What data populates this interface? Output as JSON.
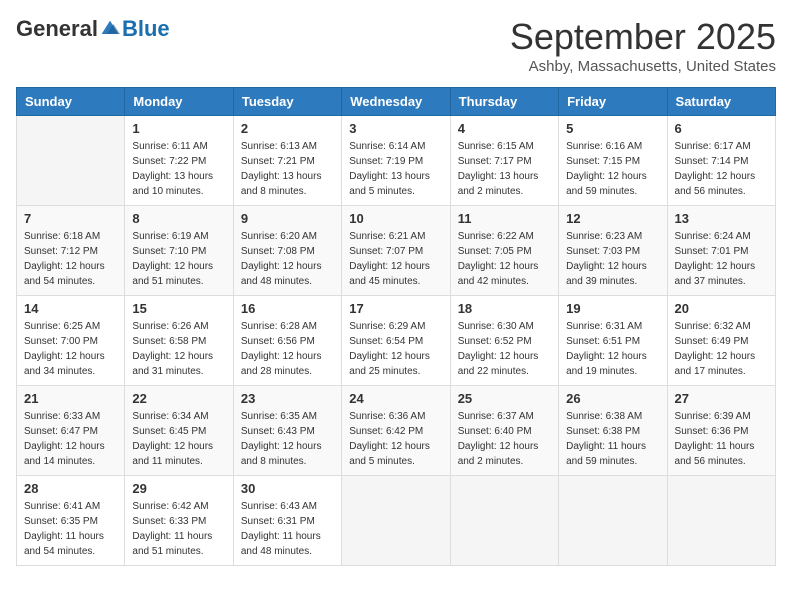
{
  "logo": {
    "general": "General",
    "blue": "Blue"
  },
  "title": "September 2025",
  "location": "Ashby, Massachusetts, United States",
  "days_of_week": [
    "Sunday",
    "Monday",
    "Tuesday",
    "Wednesday",
    "Thursday",
    "Friday",
    "Saturday"
  ],
  "weeks": [
    [
      {
        "day": "",
        "info": ""
      },
      {
        "day": "1",
        "info": "Sunrise: 6:11 AM\nSunset: 7:22 PM\nDaylight: 13 hours\nand 10 minutes."
      },
      {
        "day": "2",
        "info": "Sunrise: 6:13 AM\nSunset: 7:21 PM\nDaylight: 13 hours\nand 8 minutes."
      },
      {
        "day": "3",
        "info": "Sunrise: 6:14 AM\nSunset: 7:19 PM\nDaylight: 13 hours\nand 5 minutes."
      },
      {
        "day": "4",
        "info": "Sunrise: 6:15 AM\nSunset: 7:17 PM\nDaylight: 13 hours\nand 2 minutes."
      },
      {
        "day": "5",
        "info": "Sunrise: 6:16 AM\nSunset: 7:15 PM\nDaylight: 12 hours\nand 59 minutes."
      },
      {
        "day": "6",
        "info": "Sunrise: 6:17 AM\nSunset: 7:14 PM\nDaylight: 12 hours\nand 56 minutes."
      }
    ],
    [
      {
        "day": "7",
        "info": "Sunrise: 6:18 AM\nSunset: 7:12 PM\nDaylight: 12 hours\nand 54 minutes."
      },
      {
        "day": "8",
        "info": "Sunrise: 6:19 AM\nSunset: 7:10 PM\nDaylight: 12 hours\nand 51 minutes."
      },
      {
        "day": "9",
        "info": "Sunrise: 6:20 AM\nSunset: 7:08 PM\nDaylight: 12 hours\nand 48 minutes."
      },
      {
        "day": "10",
        "info": "Sunrise: 6:21 AM\nSunset: 7:07 PM\nDaylight: 12 hours\nand 45 minutes."
      },
      {
        "day": "11",
        "info": "Sunrise: 6:22 AM\nSunset: 7:05 PM\nDaylight: 12 hours\nand 42 minutes."
      },
      {
        "day": "12",
        "info": "Sunrise: 6:23 AM\nSunset: 7:03 PM\nDaylight: 12 hours\nand 39 minutes."
      },
      {
        "day": "13",
        "info": "Sunrise: 6:24 AM\nSunset: 7:01 PM\nDaylight: 12 hours\nand 37 minutes."
      }
    ],
    [
      {
        "day": "14",
        "info": "Sunrise: 6:25 AM\nSunset: 7:00 PM\nDaylight: 12 hours\nand 34 minutes."
      },
      {
        "day": "15",
        "info": "Sunrise: 6:26 AM\nSunset: 6:58 PM\nDaylight: 12 hours\nand 31 minutes."
      },
      {
        "day": "16",
        "info": "Sunrise: 6:28 AM\nSunset: 6:56 PM\nDaylight: 12 hours\nand 28 minutes."
      },
      {
        "day": "17",
        "info": "Sunrise: 6:29 AM\nSunset: 6:54 PM\nDaylight: 12 hours\nand 25 minutes."
      },
      {
        "day": "18",
        "info": "Sunrise: 6:30 AM\nSunset: 6:52 PM\nDaylight: 12 hours\nand 22 minutes."
      },
      {
        "day": "19",
        "info": "Sunrise: 6:31 AM\nSunset: 6:51 PM\nDaylight: 12 hours\nand 19 minutes."
      },
      {
        "day": "20",
        "info": "Sunrise: 6:32 AM\nSunset: 6:49 PM\nDaylight: 12 hours\nand 17 minutes."
      }
    ],
    [
      {
        "day": "21",
        "info": "Sunrise: 6:33 AM\nSunset: 6:47 PM\nDaylight: 12 hours\nand 14 minutes."
      },
      {
        "day": "22",
        "info": "Sunrise: 6:34 AM\nSunset: 6:45 PM\nDaylight: 12 hours\nand 11 minutes."
      },
      {
        "day": "23",
        "info": "Sunrise: 6:35 AM\nSunset: 6:43 PM\nDaylight: 12 hours\nand 8 minutes."
      },
      {
        "day": "24",
        "info": "Sunrise: 6:36 AM\nSunset: 6:42 PM\nDaylight: 12 hours\nand 5 minutes."
      },
      {
        "day": "25",
        "info": "Sunrise: 6:37 AM\nSunset: 6:40 PM\nDaylight: 12 hours\nand 2 minutes."
      },
      {
        "day": "26",
        "info": "Sunrise: 6:38 AM\nSunset: 6:38 PM\nDaylight: 11 hours\nand 59 minutes."
      },
      {
        "day": "27",
        "info": "Sunrise: 6:39 AM\nSunset: 6:36 PM\nDaylight: 11 hours\nand 56 minutes."
      }
    ],
    [
      {
        "day": "28",
        "info": "Sunrise: 6:41 AM\nSunset: 6:35 PM\nDaylight: 11 hours\nand 54 minutes."
      },
      {
        "day": "29",
        "info": "Sunrise: 6:42 AM\nSunset: 6:33 PM\nDaylight: 11 hours\nand 51 minutes."
      },
      {
        "day": "30",
        "info": "Sunrise: 6:43 AM\nSunset: 6:31 PM\nDaylight: 11 hours\nand 48 minutes."
      },
      {
        "day": "",
        "info": ""
      },
      {
        "day": "",
        "info": ""
      },
      {
        "day": "",
        "info": ""
      },
      {
        "day": "",
        "info": ""
      }
    ]
  ]
}
